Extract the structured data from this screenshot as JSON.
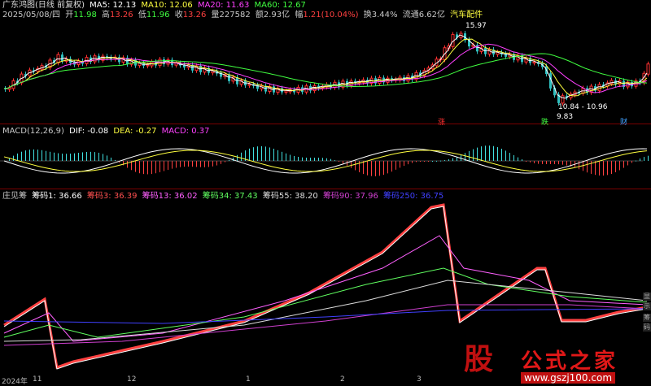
{
  "header": {
    "title": "广东鸿图(日线 前复权)",
    "date": "2025/05/08/四",
    "open_label": "开",
    "open": "11.98",
    "high_label": "高",
    "high": "13.26",
    "low_label": "低",
    "low": "11.96",
    "close_label": "收",
    "close": "13.26",
    "volume_label": "量",
    "volume": "227582",
    "amount_label": "额",
    "amount": "2.93亿",
    "change_label": "幅",
    "change": "1.21(10.04%)",
    "turnover_label": "换",
    "turnover": "3.44%",
    "float_label": "流通",
    "float": "6.62亿",
    "sector": "汽车配件",
    "ma5": "MA5: 12.13",
    "ma10": "MA10: 12.06",
    "ma20": "MA20: 11.63",
    "ma60": "MA60: 12.67"
  },
  "price_annotations": {
    "peak": "15.97",
    "range": "10.84 - 10.96",
    "low": "9.83",
    "tag_zhang": "涨",
    "tag_die": "跌",
    "tag_cai": "财"
  },
  "macd": {
    "title": "MACD(12,26,9)",
    "dif": "DIF: -0.08",
    "dea": "DEA: -0.27",
    "macd": "MACD: 0.37"
  },
  "chip": {
    "title": "庄见筹",
    "c1": "筹码1: 36.66",
    "c3": "筹码3: 36.39",
    "c13": "筹码13: 36.02",
    "c34": "筹码34: 37.43",
    "c55": "筹码55: 38.20",
    "c90": "筹码90: 37.96",
    "c250": "筹码250: 36.75"
  },
  "side_buttons": [
    "显",
    "示",
    "筹",
    "码"
  ],
  "xaxis": [
    "2024年",
    "11",
    "12",
    "1",
    "2",
    "3"
  ],
  "colors": {
    "up": "#ff3030",
    "down": "#30c0c0",
    "ma5": "#ffffff",
    "ma10": "#ffff40",
    "ma20": "#ff40ff",
    "ma60": "#40ff40",
    "accent_red": "#c01010"
  },
  "watermark": {
    "logo": "股",
    "brand": "公式之家",
    "url": "www.gszj100.com"
  }
}
